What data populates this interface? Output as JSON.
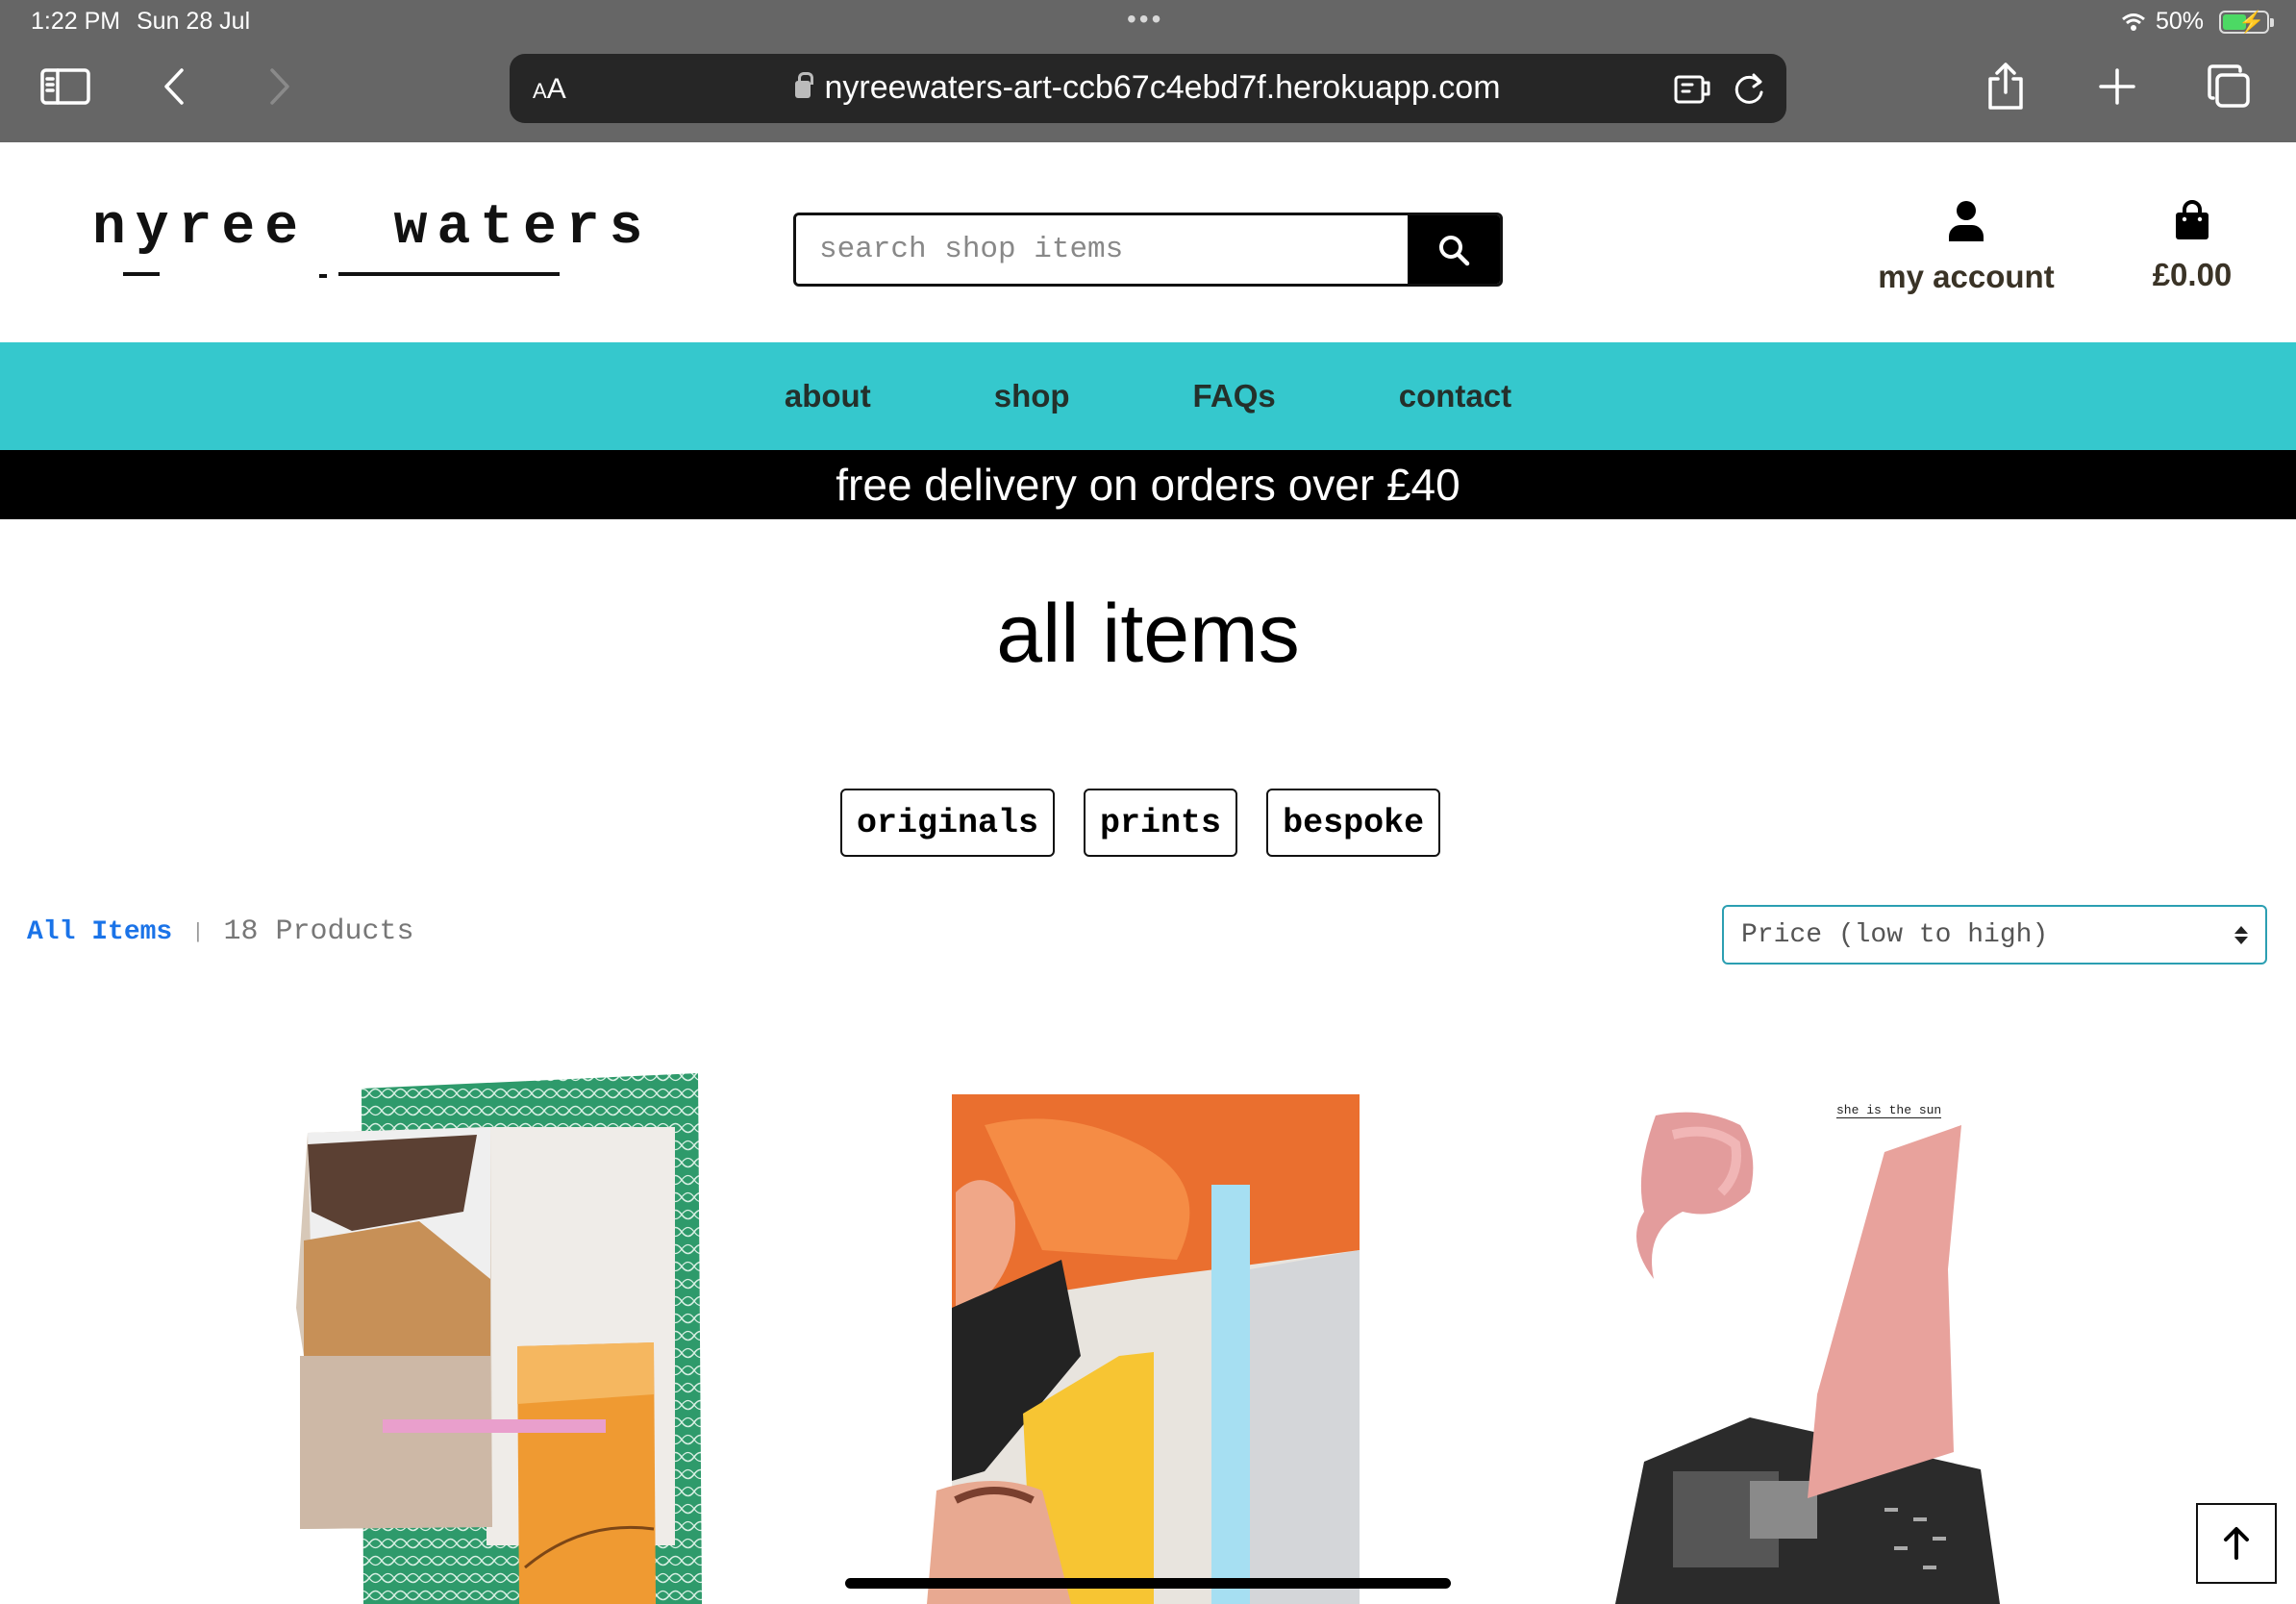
{
  "status_bar": {
    "time": "1:22 PM",
    "date": "Sun 28 Jul",
    "battery": "50%"
  },
  "browser": {
    "text_size_label": "AA",
    "url": "nyreewaters-art-ccb67c4ebd7f.herokuapp.com"
  },
  "header": {
    "logo": "nyree  waters",
    "search_placeholder": "search shop items",
    "account_label": "my account",
    "bag_total": "£0.00"
  },
  "nav": {
    "items": [
      "about",
      "shop",
      "FAQs",
      "contact"
    ]
  },
  "banner": {
    "text": "free delivery on orders over £40"
  },
  "main": {
    "title": "all items",
    "categories": [
      "originals",
      "prints",
      "bespoke"
    ],
    "breadcrumb": "All Items",
    "separator": "|",
    "product_count": "18 Products",
    "sort_value": "Price (low to high)"
  },
  "products": [
    {
      "caption": ""
    },
    {
      "caption": ""
    },
    {
      "caption": "she is the sun"
    }
  ],
  "colors": {
    "nav_bg": "#35c8cd",
    "banner_bg": "#000000",
    "link": "#1a73e8",
    "chrome_bg": "#666666"
  }
}
